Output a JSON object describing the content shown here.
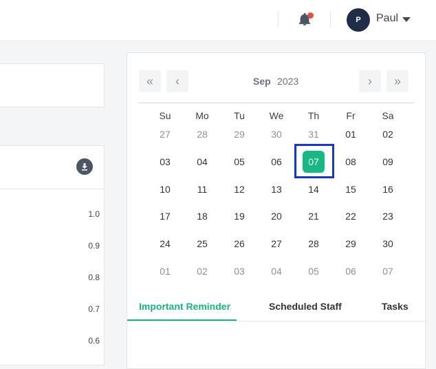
{
  "header": {
    "user_initial": "P",
    "user_name": "Paul",
    "notification_dot_color": "#f04b3a"
  },
  "chart_panel": {
    "y_ticks": [
      "1.0",
      "0.9",
      "0.8",
      "0.7",
      "0.6"
    ]
  },
  "calendar": {
    "month": "Sep",
    "year": "2023",
    "weekdays": [
      "Su",
      "Mo",
      "Tu",
      "We",
      "Th",
      "Fr",
      "Sa"
    ],
    "weeks": [
      [
        "27",
        "28",
        "29",
        "30",
        "31",
        "01",
        "02"
      ],
      [
        "03",
        "04",
        "05",
        "06",
        "07",
        "08",
        "09"
      ],
      [
        "10",
        "11",
        "12",
        "13",
        "14",
        "15",
        "16"
      ],
      [
        "17",
        "18",
        "19",
        "20",
        "21",
        "22",
        "23"
      ],
      [
        "24",
        "25",
        "26",
        "27",
        "28",
        "29",
        "30"
      ],
      [
        "01",
        "02",
        "03",
        "04",
        "05",
        "06",
        "07"
      ]
    ],
    "selected_date": "07",
    "accent_color": "#17b884"
  },
  "tabs": [
    {
      "label": "Important Reminder",
      "active": true
    },
    {
      "label": "Scheduled Staff",
      "active": false
    },
    {
      "label": "Tasks",
      "active": false
    }
  ]
}
